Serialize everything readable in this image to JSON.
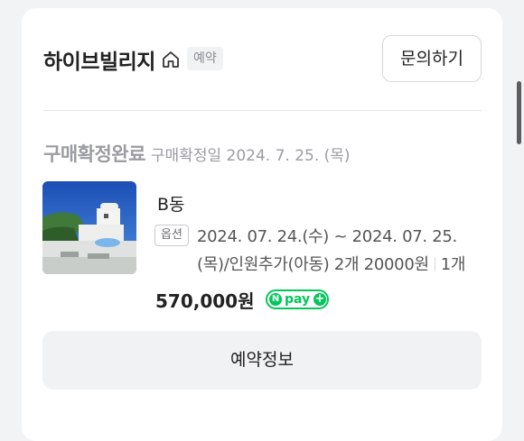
{
  "header": {
    "shop_name": "하이브빌리지",
    "tag": "예약",
    "inquiry_label": "문의하기"
  },
  "order": {
    "status": "구매확정완료",
    "confirm_date": "구매확정일 2024. 7. 25. (목)"
  },
  "product": {
    "name": "B동",
    "option_badge": "옵션",
    "option_text": "2024. 07. 24.(수) ~ 2024. 07. 25.(목)/인원추가(아동) 2개 20000원",
    "quantity": "1개",
    "price": "570,000원",
    "payment_badge": "pay"
  },
  "actions": {
    "booking_info_label": "예약정보"
  },
  "colors": {
    "npay_green": "#03c75a",
    "muted_text": "#9a9ca1",
    "button_bg": "#f1f2f4"
  }
}
